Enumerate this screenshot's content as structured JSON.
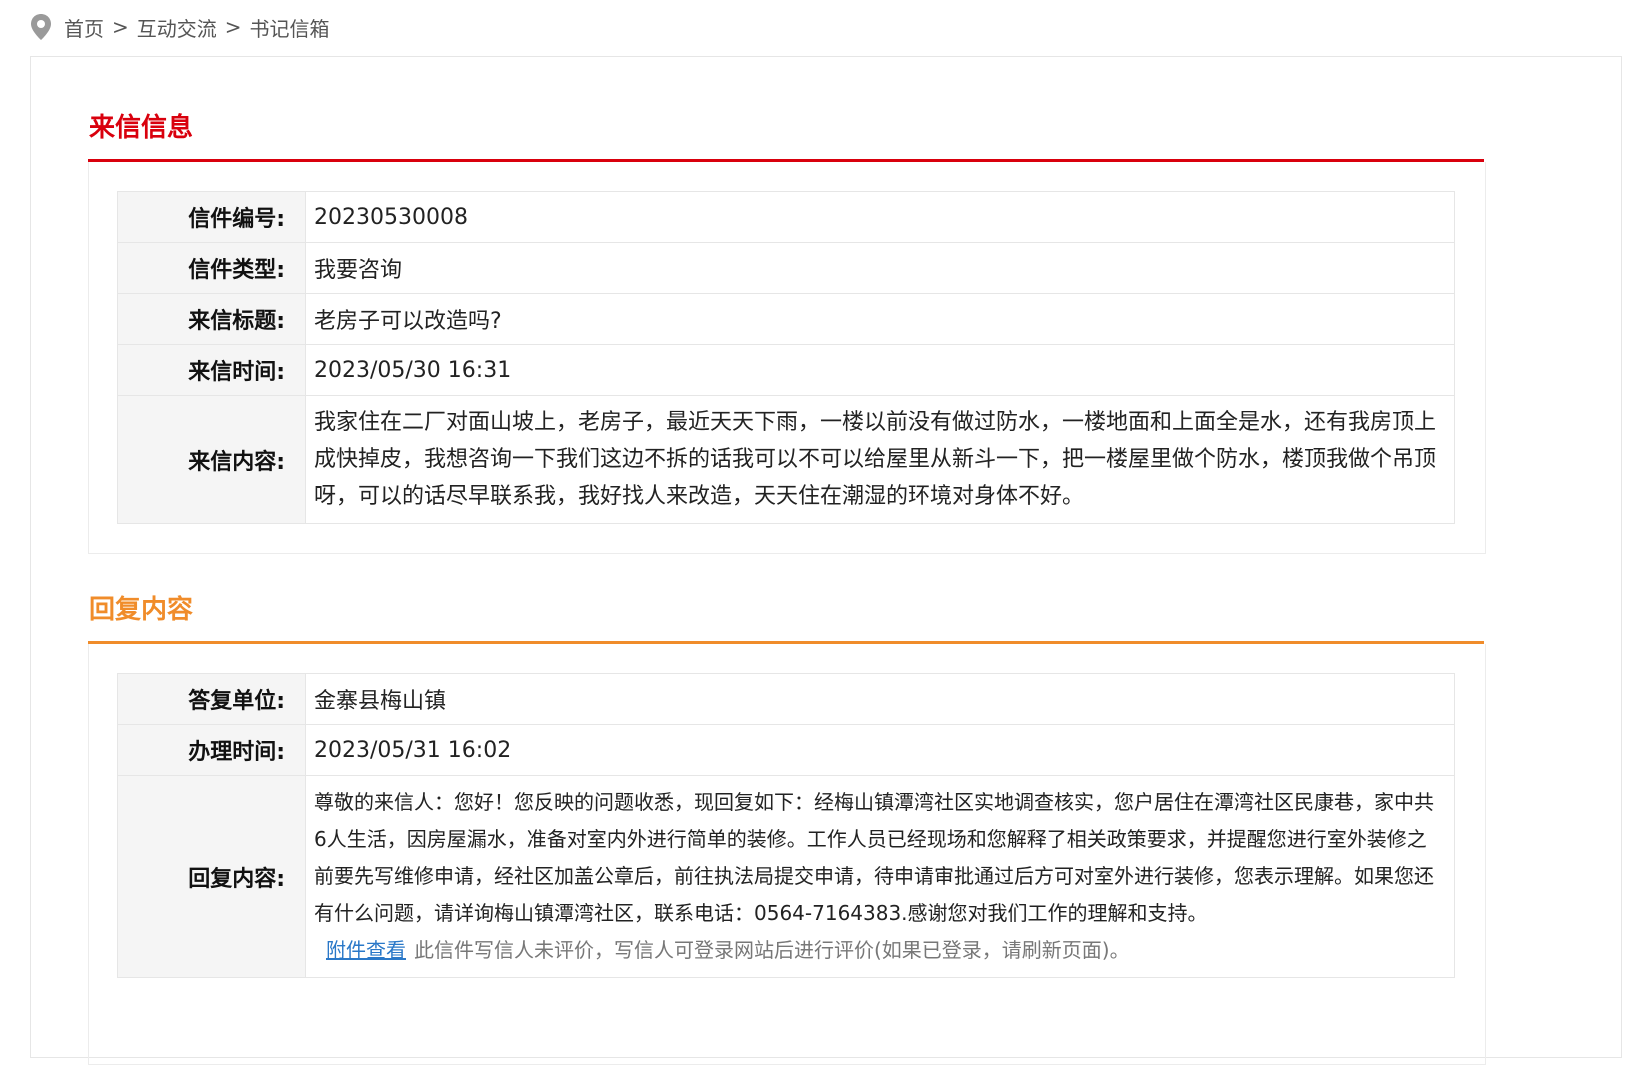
{
  "breadcrumb": {
    "items": [
      "首页",
      "互动交流",
      "书记信箱"
    ],
    "separator": ">"
  },
  "letter": {
    "title": "来信信息",
    "accent": "#d9000d",
    "rows": [
      {
        "label": "信件编号:",
        "value": "20230530008"
      },
      {
        "label": "信件类型:",
        "value": "我要咨询"
      },
      {
        "label": "来信标题:",
        "value": "老房子可以改造吗?"
      },
      {
        "label": "来信时间:",
        "value": "2023/05/30 16:31"
      },
      {
        "label": "来信内容:",
        "value": "我家住在二厂对面山坡上，老房子，最近天天下雨，一楼以前没有做过防水，一楼地面和上面全是水，还有我房顶上成快掉皮，我想咨询一下我们这边不拆的话我可以不可以给屋里从新斗一下，把一楼屋里做个防水，楼顶我做个吊顶呀，可以的话尽早联系我，我好找人来改造，天天住在潮湿的环境对身体不好。"
      }
    ]
  },
  "reply": {
    "title": "回复内容",
    "accent": "#f08c2a",
    "rows": [
      {
        "label": "答复单位:",
        "value": "金寨县梅山镇"
      },
      {
        "label": "办理时间:",
        "value": "2023/05/31 16:02"
      },
      {
        "label": "回复内容:",
        "value": "尊敬的来信人：您好！您反映的问题收悉，现回复如下：经梅山镇潭湾社区实地调查核实，您户居住在潭湾社区民康巷，家中共6人生活，因房屋漏水，准备对室内外进行简单的装修。工作人员已经现场和您解释了相关政策要求，并提醒您进行室外装修之前要先写维修申请，经社区加盖公章后，前往执法局提交申请，待申请审批通过后方可对室外进行装修，您表示理解。如果您还有什么问题，请详询梅山镇潭湾社区，联系电话：0564-7164383.感谢您对我们工作的理解和支持。"
      }
    ],
    "attachment_link": "附件查看",
    "evaluation_note": "此信件写信人未评价，写信人可登录网站后进行评价(如果已登录，请刷新页面)。"
  }
}
